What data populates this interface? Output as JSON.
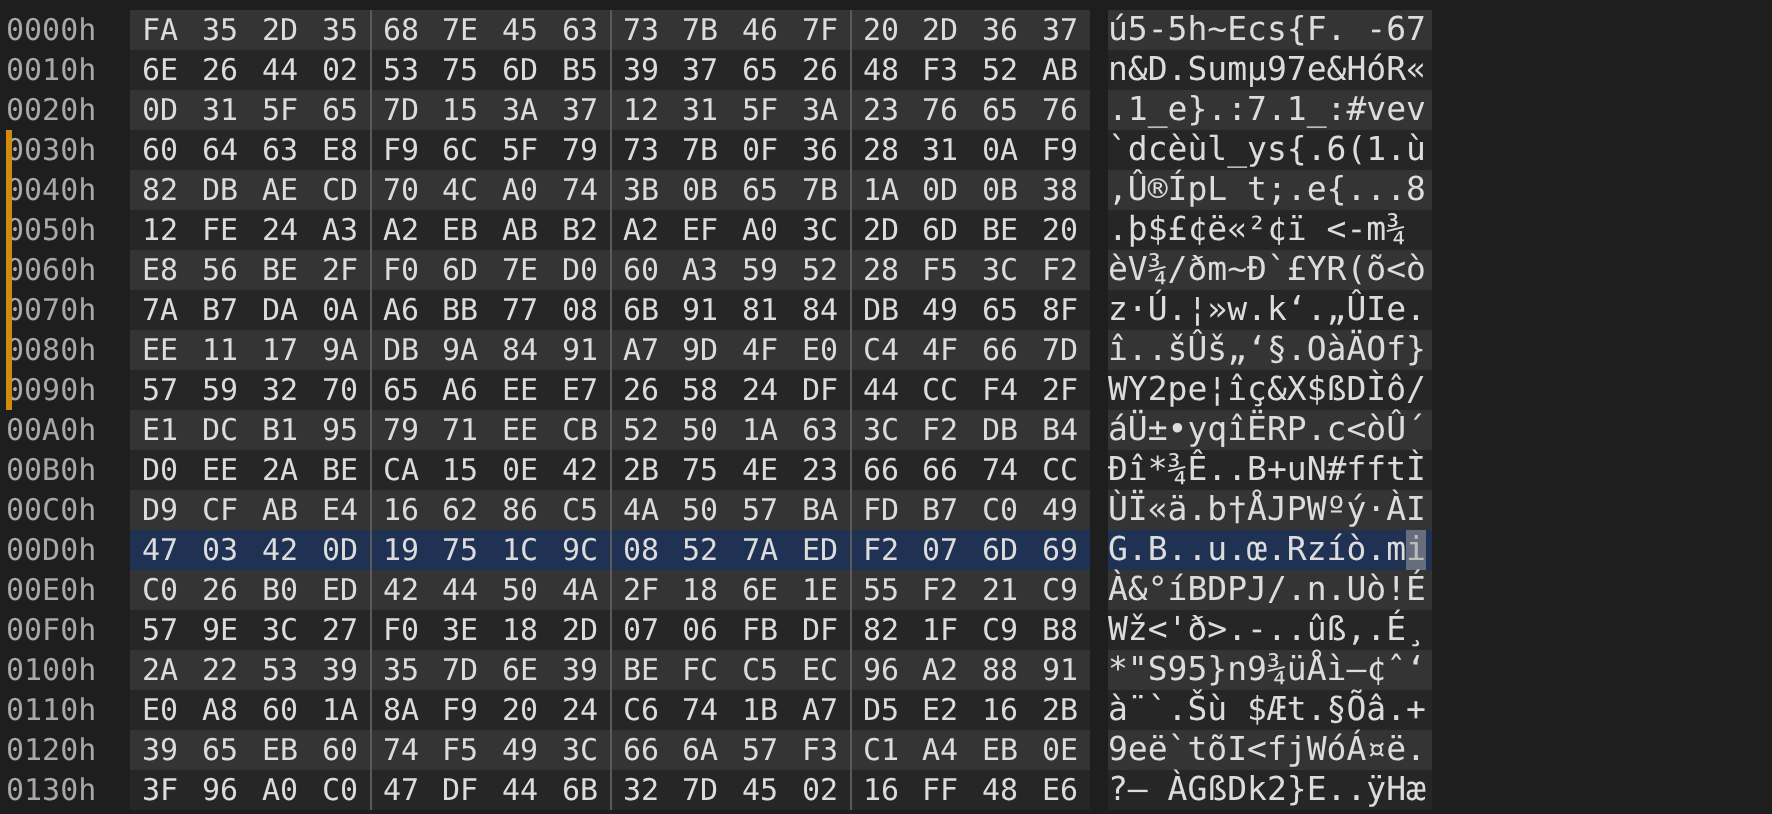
{
  "rows": [
    {
      "offset": "0000h",
      "bytes": [
        "FA",
        "35",
        "2D",
        "35",
        "68",
        "7E",
        "45",
        "63",
        "73",
        "7B",
        "46",
        "7F",
        "20",
        "2D",
        "36",
        "37"
      ],
      "ascii": "ú5-5h~Ecs{F. -67",
      "modified": false,
      "selected": false,
      "cursor": false
    },
    {
      "offset": "0010h",
      "bytes": [
        "6E",
        "26",
        "44",
        "02",
        "53",
        "75",
        "6D",
        "B5",
        "39",
        "37",
        "65",
        "26",
        "48",
        "F3",
        "52",
        "AB"
      ],
      "ascii": "n&D.Sumµ97e&HóR«",
      "modified": false,
      "selected": false,
      "cursor": false
    },
    {
      "offset": "0020h",
      "bytes": [
        "0D",
        "31",
        "5F",
        "65",
        "7D",
        "15",
        "3A",
        "37",
        "12",
        "31",
        "5F",
        "3A",
        "23",
        "76",
        "65",
        "76"
      ],
      "ascii": ".1_e}.:7.1_:#vev",
      "modified": false,
      "selected": false,
      "cursor": false
    },
    {
      "offset": "0030h",
      "bytes": [
        "60",
        "64",
        "63",
        "E8",
        "F9",
        "6C",
        "5F",
        "79",
        "73",
        "7B",
        "0F",
        "36",
        "28",
        "31",
        "0A",
        "F9"
      ],
      "ascii": "`dcèùl_ys{.6(1.ù",
      "modified": true,
      "selected": false,
      "cursor": false
    },
    {
      "offset": "0040h",
      "bytes": [
        "82",
        "DB",
        "AE",
        "CD",
        "70",
        "4C",
        "A0",
        "74",
        "3B",
        "0B",
        "65",
        "7B",
        "1A",
        "0D",
        "0B",
        "38"
      ],
      "ascii": "‚Û®ÍpL t;.e{...8",
      "modified": true,
      "selected": false,
      "cursor": false
    },
    {
      "offset": "0050h",
      "bytes": [
        "12",
        "FE",
        "24",
        "A3",
        "A2",
        "EB",
        "AB",
        "B2",
        "A2",
        "EF",
        "A0",
        "3C",
        "2D",
        "6D",
        "BE",
        "20"
      ],
      "ascii": ".þ$£¢ë«²¢ï <-m¾",
      "modified": true,
      "selected": false,
      "cursor": false
    },
    {
      "offset": "0060h",
      "bytes": [
        "E8",
        "56",
        "BE",
        "2F",
        "F0",
        "6D",
        "7E",
        "D0",
        "60",
        "A3",
        "59",
        "52",
        "28",
        "F5",
        "3C",
        "F2"
      ],
      "ascii": "èV¾/ðm~Ð`£YR(õ<ò",
      "modified": true,
      "selected": false,
      "cursor": false
    },
    {
      "offset": "0070h",
      "bytes": [
        "7A",
        "B7",
        "DA",
        "0A",
        "A6",
        "BB",
        "77",
        "08",
        "6B",
        "91",
        "81",
        "84",
        "DB",
        "49",
        "65",
        "8F"
      ],
      "ascii": "z·Ú.¦»w.k‘.„ÛIe.",
      "modified": true,
      "selected": false,
      "cursor": false
    },
    {
      "offset": "0080h",
      "bytes": [
        "EE",
        "11",
        "17",
        "9A",
        "DB",
        "9A",
        "84",
        "91",
        "A7",
        "9D",
        "4F",
        "E0",
        "C4",
        "4F",
        "66",
        "7D"
      ],
      "ascii": "î..šÛš„‘§.OàÄOf}",
      "modified": true,
      "selected": false,
      "cursor": false
    },
    {
      "offset": "0090h",
      "bytes": [
        "57",
        "59",
        "32",
        "70",
        "65",
        "A6",
        "EE",
        "E7",
        "26",
        "58",
        "24",
        "DF",
        "44",
        "CC",
        "F4",
        "2F"
      ],
      "ascii": "WY2pe¦îç&X$ßDÌô/",
      "modified": true,
      "selected": false,
      "cursor": false
    },
    {
      "offset": "00A0h",
      "bytes": [
        "E1",
        "DC",
        "B1",
        "95",
        "79",
        "71",
        "EE",
        "CB",
        "52",
        "50",
        "1A",
        "63",
        "3C",
        "F2",
        "DB",
        "B4"
      ],
      "ascii": "áÜ±•yqîËRP.c<òÛ´",
      "modified": false,
      "selected": false,
      "cursor": false
    },
    {
      "offset": "00B0h",
      "bytes": [
        "D0",
        "EE",
        "2A",
        "BE",
        "CA",
        "15",
        "0E",
        "42",
        "2B",
        "75",
        "4E",
        "23",
        "66",
        "66",
        "74",
        "CC"
      ],
      "ascii": "Ðî*¾Ê..B+uN#fftÌ",
      "modified": false,
      "selected": false,
      "cursor": false
    },
    {
      "offset": "00C0h",
      "bytes": [
        "D9",
        "CF",
        "AB",
        "E4",
        "16",
        "62",
        "86",
        "C5",
        "4A",
        "50",
        "57",
        "BA",
        "FD",
        "B7",
        "C0",
        "49"
      ],
      "ascii": "ÙÏ«ä.b†ÅJPWºý·ÀI",
      "modified": false,
      "selected": false,
      "cursor": false
    },
    {
      "offset": "00D0h",
      "bytes": [
        "47",
        "03",
        "42",
        "0D",
        "19",
        "75",
        "1C",
        "9C",
        "08",
        "52",
        "7A",
        "ED",
        "F2",
        "07",
        "6D",
        "69"
      ],
      "ascii": "G.B..u.œ.Rzíò.mi",
      "modified": false,
      "selected": true,
      "cursor": true
    },
    {
      "offset": "00E0h",
      "bytes": [
        "C0",
        "26",
        "B0",
        "ED",
        "42",
        "44",
        "50",
        "4A",
        "2F",
        "18",
        "6E",
        "1E",
        "55",
        "F2",
        "21",
        "C9"
      ],
      "ascii": "À&°íBDPJ/.n.Uò!É",
      "modified": false,
      "selected": false,
      "cursor": false
    },
    {
      "offset": "00F0h",
      "bytes": [
        "57",
        "9E",
        "3C",
        "27",
        "F0",
        "3E",
        "18",
        "2D",
        "07",
        "06",
        "FB",
        "DF",
        "82",
        "1F",
        "C9",
        "B8"
      ],
      "ascii": "Wž<'ð>.-..ûß‚.É¸",
      "modified": false,
      "selected": false,
      "cursor": false
    },
    {
      "offset": "0100h",
      "bytes": [
        "2A",
        "22",
        "53",
        "39",
        "35",
        "7D",
        "6E",
        "39",
        "BE",
        "FC",
        "C5",
        "EC",
        "96",
        "A2",
        "88",
        "91"
      ],
      "ascii": "*\"S95}n9¾üÅì–¢ˆ‘",
      "modified": false,
      "selected": false,
      "cursor": false
    },
    {
      "offset": "0110h",
      "bytes": [
        "E0",
        "A8",
        "60",
        "1A",
        "8A",
        "F9",
        "20",
        "24",
        "C6",
        "74",
        "1B",
        "A7",
        "D5",
        "E2",
        "16",
        "2B"
      ],
      "ascii": "à¨`.Šù $Æt.§Õâ.+",
      "modified": false,
      "selected": false,
      "cursor": false
    },
    {
      "offset": "0120h",
      "bytes": [
        "39",
        "65",
        "EB",
        "60",
        "74",
        "F5",
        "49",
        "3C",
        "66",
        "6A",
        "57",
        "F3",
        "C1",
        "A4",
        "EB",
        "0E"
      ],
      "ascii": "9eë`tõI<fjWóÁ¤ë.",
      "modified": false,
      "selected": false,
      "cursor": false
    },
    {
      "offset": "0130h",
      "bytes": [
        "3F",
        "96",
        "A0",
        "C0",
        "47",
        "DF",
        "44",
        "6B",
        "32",
        "7D",
        "45",
        "02",
        "16",
        "FF",
        "48",
        "E6"
      ],
      "ascii": "?– ÀGßDk2}E..ÿHæ",
      "modified": false,
      "selected": false,
      "cursor": false
    }
  ]
}
